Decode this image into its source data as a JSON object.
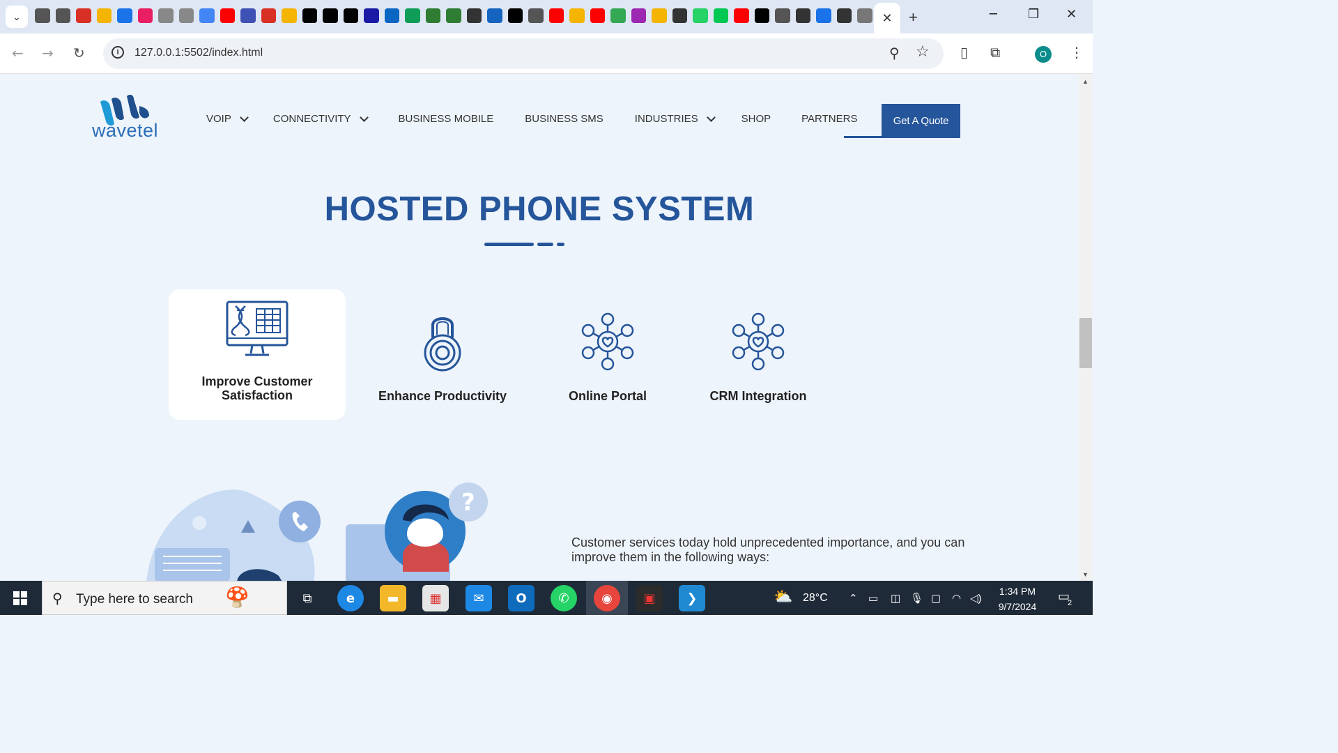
{
  "browser": {
    "url": "127.0.0.1:5502/index.html",
    "tab_close_symbol": "✕",
    "new_tab_symbol": "+"
  },
  "site": {
    "logo_text": "wavetel",
    "nav": [
      {
        "label": "VOIP",
        "dropdown": true
      },
      {
        "label": "CONNECTIVITY",
        "dropdown": true
      },
      {
        "label": "BUSINESS MOBILE",
        "dropdown": false
      },
      {
        "label": "BUSINESS SMS",
        "dropdown": false
      },
      {
        "label": "INDUSTRIES",
        "dropdown": true
      },
      {
        "label": "SHOP",
        "dropdown": false
      },
      {
        "label": "PARTNERS",
        "dropdown": false
      }
    ],
    "quote_button": "Get A Quote",
    "accent_color": "#25559a"
  },
  "main": {
    "title": "HOSTED PHONE SYSTEM",
    "features": [
      {
        "label": "Improve Customer Satisfaction",
        "icon": "dna-monitor-icon",
        "active": true
      },
      {
        "label": "Enhance Productivity",
        "icon": "padlock-icon",
        "active": false
      },
      {
        "label": "Online Portal",
        "icon": "network-people-icon",
        "active": false
      },
      {
        "label": "CRM Integration",
        "icon": "network-people-icon",
        "active": false
      }
    ],
    "description": "Customer services today hold unprecedented importance, and you can improve them in the following ways:"
  },
  "taskbar": {
    "search_placeholder": "Type here to search",
    "weather": "28°C",
    "time": "1:34 PM",
    "date": "9/7/2024",
    "notification_count": "2"
  }
}
